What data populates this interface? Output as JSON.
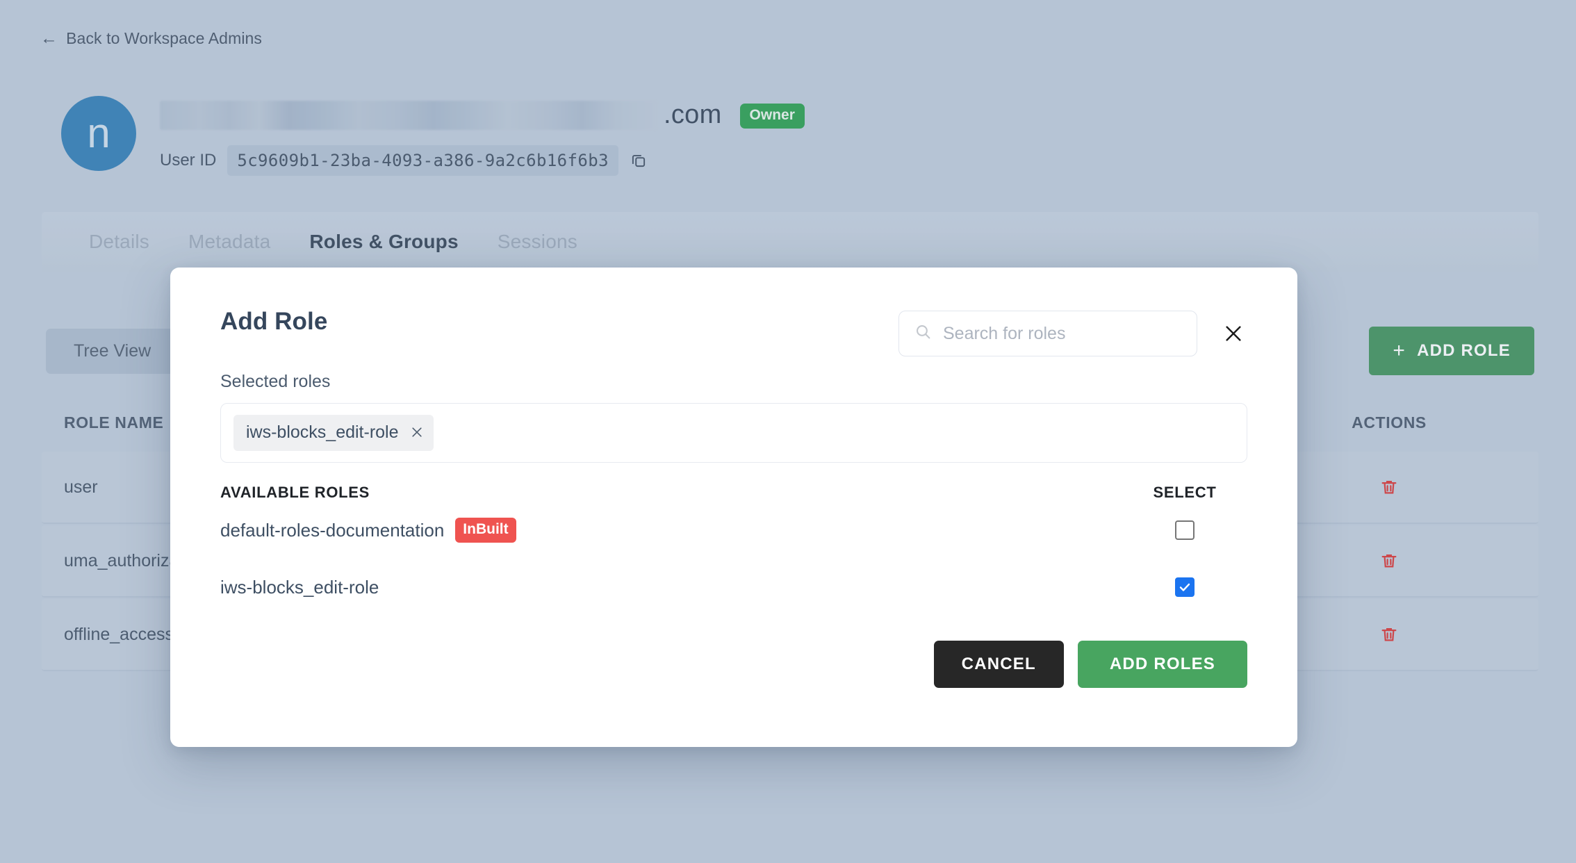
{
  "background": {
    "back_link": {
      "label": "Back to Workspace Admins",
      "icon": "arrow-left-icon"
    },
    "user": {
      "avatar_initial": "n",
      "name_tld": ".com",
      "name_redacted": true,
      "badge": "Owner",
      "badge_color": "#21a049",
      "user_id_label": "User ID",
      "user_id_value": "5c9609b1-23ba-4093-a386-9a2c6b16f6b3",
      "copy_icon": "copy-icon"
    },
    "tabs": [
      {
        "label": "Details",
        "active": false
      },
      {
        "label": "Metadata",
        "active": false
      },
      {
        "label": "Roles & Groups",
        "active": true
      },
      {
        "label": "Sessions",
        "active": false
      }
    ],
    "toolbar": {
      "tree_view_label": "Tree View",
      "add_role_label": "ADD ROLE",
      "add_role_icon": "plus-icon",
      "add_role_color": "#3a9257"
    },
    "table": {
      "columns": [
        "ROLE NAME",
        "ACTIONS"
      ],
      "rows": [
        {
          "role_name": "user",
          "action_icon": "trash-icon"
        },
        {
          "role_name": "uma_authorization",
          "action_icon": "trash-icon"
        },
        {
          "role_name": "offline_access",
          "action_icon": "trash-icon"
        }
      ],
      "action_icon_color": "#e03131"
    }
  },
  "modal": {
    "title": "Add Role",
    "search": {
      "placeholder": "Search for roles",
      "value": "",
      "icon": "search-icon"
    },
    "close_icon": "close-icon",
    "selected_roles_label": "Selected roles",
    "selected_roles": [
      {
        "label": "iws-blocks_edit-role",
        "remove_icon": "close-icon"
      }
    ],
    "available": {
      "header_name": "AVAILABLE ROLES",
      "header_select": "SELECT",
      "rows": [
        {
          "name": "default-roles-documentation",
          "badge": "InBuilt",
          "badge_color": "#ef5350",
          "checked": false
        },
        {
          "name": "iws-blocks_edit-role",
          "badge": "",
          "badge_color": "",
          "checked": true
        }
      ]
    },
    "buttons": {
      "cancel": "CANCEL",
      "add": "ADD ROLES",
      "cancel_color": "#272727",
      "add_color": "#48a560"
    }
  }
}
